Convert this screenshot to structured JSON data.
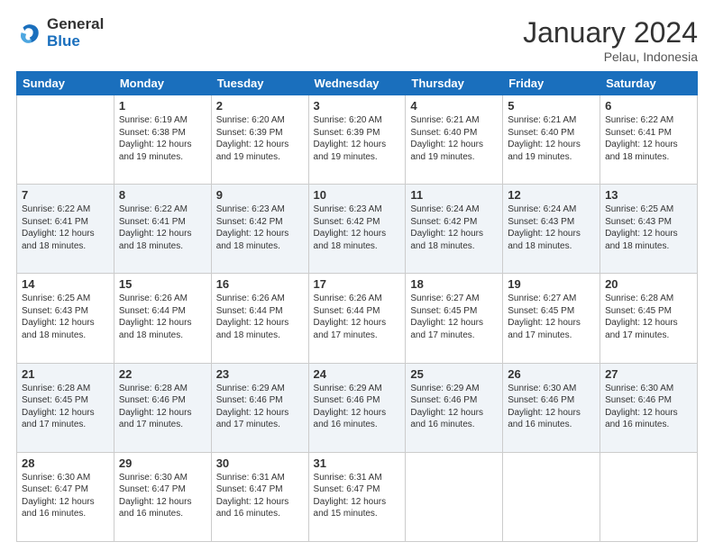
{
  "header": {
    "logo_general": "General",
    "logo_blue": "Blue",
    "month": "January 2024",
    "location": "Pelau, Indonesia"
  },
  "days_of_week": [
    "Sunday",
    "Monday",
    "Tuesday",
    "Wednesday",
    "Thursday",
    "Friday",
    "Saturday"
  ],
  "weeks": [
    [
      {
        "day": "",
        "sunrise": "",
        "sunset": "",
        "daylight": "",
        "empty": true
      },
      {
        "day": "1",
        "sunrise": "Sunrise: 6:19 AM",
        "sunset": "Sunset: 6:38 PM",
        "daylight": "Daylight: 12 hours and 19 minutes."
      },
      {
        "day": "2",
        "sunrise": "Sunrise: 6:20 AM",
        "sunset": "Sunset: 6:39 PM",
        "daylight": "Daylight: 12 hours and 19 minutes."
      },
      {
        "day": "3",
        "sunrise": "Sunrise: 6:20 AM",
        "sunset": "Sunset: 6:39 PM",
        "daylight": "Daylight: 12 hours and 19 minutes."
      },
      {
        "day": "4",
        "sunrise": "Sunrise: 6:21 AM",
        "sunset": "Sunset: 6:40 PM",
        "daylight": "Daylight: 12 hours and 19 minutes."
      },
      {
        "day": "5",
        "sunrise": "Sunrise: 6:21 AM",
        "sunset": "Sunset: 6:40 PM",
        "daylight": "Daylight: 12 hours and 19 minutes."
      },
      {
        "day": "6",
        "sunrise": "Sunrise: 6:22 AM",
        "sunset": "Sunset: 6:41 PM",
        "daylight": "Daylight: 12 hours and 18 minutes."
      }
    ],
    [
      {
        "day": "7",
        "sunrise": "Sunrise: 6:22 AM",
        "sunset": "Sunset: 6:41 PM",
        "daylight": "Daylight: 12 hours and 18 minutes."
      },
      {
        "day": "8",
        "sunrise": "Sunrise: 6:22 AM",
        "sunset": "Sunset: 6:41 PM",
        "daylight": "Daylight: 12 hours and 18 minutes."
      },
      {
        "day": "9",
        "sunrise": "Sunrise: 6:23 AM",
        "sunset": "Sunset: 6:42 PM",
        "daylight": "Daylight: 12 hours and 18 minutes."
      },
      {
        "day": "10",
        "sunrise": "Sunrise: 6:23 AM",
        "sunset": "Sunset: 6:42 PM",
        "daylight": "Daylight: 12 hours and 18 minutes."
      },
      {
        "day": "11",
        "sunrise": "Sunrise: 6:24 AM",
        "sunset": "Sunset: 6:42 PM",
        "daylight": "Daylight: 12 hours and 18 minutes."
      },
      {
        "day": "12",
        "sunrise": "Sunrise: 6:24 AM",
        "sunset": "Sunset: 6:43 PM",
        "daylight": "Daylight: 12 hours and 18 minutes."
      },
      {
        "day": "13",
        "sunrise": "Sunrise: 6:25 AM",
        "sunset": "Sunset: 6:43 PM",
        "daylight": "Daylight: 12 hours and 18 minutes."
      }
    ],
    [
      {
        "day": "14",
        "sunrise": "Sunrise: 6:25 AM",
        "sunset": "Sunset: 6:43 PM",
        "daylight": "Daylight: 12 hours and 18 minutes."
      },
      {
        "day": "15",
        "sunrise": "Sunrise: 6:26 AM",
        "sunset": "Sunset: 6:44 PM",
        "daylight": "Daylight: 12 hours and 18 minutes."
      },
      {
        "day": "16",
        "sunrise": "Sunrise: 6:26 AM",
        "sunset": "Sunset: 6:44 PM",
        "daylight": "Daylight: 12 hours and 18 minutes."
      },
      {
        "day": "17",
        "sunrise": "Sunrise: 6:26 AM",
        "sunset": "Sunset: 6:44 PM",
        "daylight": "Daylight: 12 hours and 17 minutes."
      },
      {
        "day": "18",
        "sunrise": "Sunrise: 6:27 AM",
        "sunset": "Sunset: 6:45 PM",
        "daylight": "Daylight: 12 hours and 17 minutes."
      },
      {
        "day": "19",
        "sunrise": "Sunrise: 6:27 AM",
        "sunset": "Sunset: 6:45 PM",
        "daylight": "Daylight: 12 hours and 17 minutes."
      },
      {
        "day": "20",
        "sunrise": "Sunrise: 6:28 AM",
        "sunset": "Sunset: 6:45 PM",
        "daylight": "Daylight: 12 hours and 17 minutes."
      }
    ],
    [
      {
        "day": "21",
        "sunrise": "Sunrise: 6:28 AM",
        "sunset": "Sunset: 6:45 PM",
        "daylight": "Daylight: 12 hours and 17 minutes."
      },
      {
        "day": "22",
        "sunrise": "Sunrise: 6:28 AM",
        "sunset": "Sunset: 6:46 PM",
        "daylight": "Daylight: 12 hours and 17 minutes."
      },
      {
        "day": "23",
        "sunrise": "Sunrise: 6:29 AM",
        "sunset": "Sunset: 6:46 PM",
        "daylight": "Daylight: 12 hours and 17 minutes."
      },
      {
        "day": "24",
        "sunrise": "Sunrise: 6:29 AM",
        "sunset": "Sunset: 6:46 PM",
        "daylight": "Daylight: 12 hours and 16 minutes."
      },
      {
        "day": "25",
        "sunrise": "Sunrise: 6:29 AM",
        "sunset": "Sunset: 6:46 PM",
        "daylight": "Daylight: 12 hours and 16 minutes."
      },
      {
        "day": "26",
        "sunrise": "Sunrise: 6:30 AM",
        "sunset": "Sunset: 6:46 PM",
        "daylight": "Daylight: 12 hours and 16 minutes."
      },
      {
        "day": "27",
        "sunrise": "Sunrise: 6:30 AM",
        "sunset": "Sunset: 6:46 PM",
        "daylight": "Daylight: 12 hours and 16 minutes."
      }
    ],
    [
      {
        "day": "28",
        "sunrise": "Sunrise: 6:30 AM",
        "sunset": "Sunset: 6:47 PM",
        "daylight": "Daylight: 12 hours and 16 minutes."
      },
      {
        "day": "29",
        "sunrise": "Sunrise: 6:30 AM",
        "sunset": "Sunset: 6:47 PM",
        "daylight": "Daylight: 12 hours and 16 minutes."
      },
      {
        "day": "30",
        "sunrise": "Sunrise: 6:31 AM",
        "sunset": "Sunset: 6:47 PM",
        "daylight": "Daylight: 12 hours and 16 minutes."
      },
      {
        "day": "31",
        "sunrise": "Sunrise: 6:31 AM",
        "sunset": "Sunset: 6:47 PM",
        "daylight": "Daylight: 12 hours and 15 minutes."
      },
      {
        "day": "",
        "sunrise": "",
        "sunset": "",
        "daylight": "",
        "empty": true
      },
      {
        "day": "",
        "sunrise": "",
        "sunset": "",
        "daylight": "",
        "empty": true
      },
      {
        "day": "",
        "sunrise": "",
        "sunset": "",
        "daylight": "",
        "empty": true
      }
    ]
  ]
}
